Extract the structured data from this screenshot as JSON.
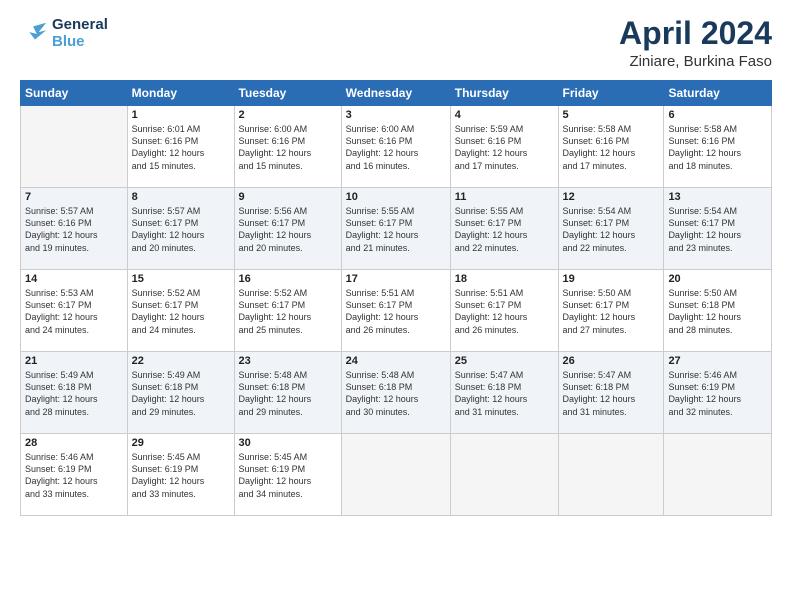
{
  "header": {
    "logo_line1": "General",
    "logo_line2": "Blue",
    "title": "April 2024",
    "location": "Ziniare, Burkina Faso"
  },
  "columns": [
    "Sunday",
    "Monday",
    "Tuesday",
    "Wednesday",
    "Thursday",
    "Friday",
    "Saturday"
  ],
  "weeks": [
    [
      {
        "day": "",
        "info": ""
      },
      {
        "day": "1",
        "info": "Sunrise: 6:01 AM\nSunset: 6:16 PM\nDaylight: 12 hours\nand 15 minutes."
      },
      {
        "day": "2",
        "info": "Sunrise: 6:00 AM\nSunset: 6:16 PM\nDaylight: 12 hours\nand 15 minutes."
      },
      {
        "day": "3",
        "info": "Sunrise: 6:00 AM\nSunset: 6:16 PM\nDaylight: 12 hours\nand 16 minutes."
      },
      {
        "day": "4",
        "info": "Sunrise: 5:59 AM\nSunset: 6:16 PM\nDaylight: 12 hours\nand 17 minutes."
      },
      {
        "day": "5",
        "info": "Sunrise: 5:58 AM\nSunset: 6:16 PM\nDaylight: 12 hours\nand 17 minutes."
      },
      {
        "day": "6",
        "info": "Sunrise: 5:58 AM\nSunset: 6:16 PM\nDaylight: 12 hours\nand 18 minutes."
      }
    ],
    [
      {
        "day": "7",
        "info": "Sunrise: 5:57 AM\nSunset: 6:16 PM\nDaylight: 12 hours\nand 19 minutes."
      },
      {
        "day": "8",
        "info": "Sunrise: 5:57 AM\nSunset: 6:17 PM\nDaylight: 12 hours\nand 20 minutes."
      },
      {
        "day": "9",
        "info": "Sunrise: 5:56 AM\nSunset: 6:17 PM\nDaylight: 12 hours\nand 20 minutes."
      },
      {
        "day": "10",
        "info": "Sunrise: 5:55 AM\nSunset: 6:17 PM\nDaylight: 12 hours\nand 21 minutes."
      },
      {
        "day": "11",
        "info": "Sunrise: 5:55 AM\nSunset: 6:17 PM\nDaylight: 12 hours\nand 22 minutes."
      },
      {
        "day": "12",
        "info": "Sunrise: 5:54 AM\nSunset: 6:17 PM\nDaylight: 12 hours\nand 22 minutes."
      },
      {
        "day": "13",
        "info": "Sunrise: 5:54 AM\nSunset: 6:17 PM\nDaylight: 12 hours\nand 23 minutes."
      }
    ],
    [
      {
        "day": "14",
        "info": "Sunrise: 5:53 AM\nSunset: 6:17 PM\nDaylight: 12 hours\nand 24 minutes."
      },
      {
        "day": "15",
        "info": "Sunrise: 5:52 AM\nSunset: 6:17 PM\nDaylight: 12 hours\nand 24 minutes."
      },
      {
        "day": "16",
        "info": "Sunrise: 5:52 AM\nSunset: 6:17 PM\nDaylight: 12 hours\nand 25 minutes."
      },
      {
        "day": "17",
        "info": "Sunrise: 5:51 AM\nSunset: 6:17 PM\nDaylight: 12 hours\nand 26 minutes."
      },
      {
        "day": "18",
        "info": "Sunrise: 5:51 AM\nSunset: 6:17 PM\nDaylight: 12 hours\nand 26 minutes."
      },
      {
        "day": "19",
        "info": "Sunrise: 5:50 AM\nSunset: 6:17 PM\nDaylight: 12 hours\nand 27 minutes."
      },
      {
        "day": "20",
        "info": "Sunrise: 5:50 AM\nSunset: 6:18 PM\nDaylight: 12 hours\nand 28 minutes."
      }
    ],
    [
      {
        "day": "21",
        "info": "Sunrise: 5:49 AM\nSunset: 6:18 PM\nDaylight: 12 hours\nand 28 minutes."
      },
      {
        "day": "22",
        "info": "Sunrise: 5:49 AM\nSunset: 6:18 PM\nDaylight: 12 hours\nand 29 minutes."
      },
      {
        "day": "23",
        "info": "Sunrise: 5:48 AM\nSunset: 6:18 PM\nDaylight: 12 hours\nand 29 minutes."
      },
      {
        "day": "24",
        "info": "Sunrise: 5:48 AM\nSunset: 6:18 PM\nDaylight: 12 hours\nand 30 minutes."
      },
      {
        "day": "25",
        "info": "Sunrise: 5:47 AM\nSunset: 6:18 PM\nDaylight: 12 hours\nand 31 minutes."
      },
      {
        "day": "26",
        "info": "Sunrise: 5:47 AM\nSunset: 6:18 PM\nDaylight: 12 hours\nand 31 minutes."
      },
      {
        "day": "27",
        "info": "Sunrise: 5:46 AM\nSunset: 6:19 PM\nDaylight: 12 hours\nand 32 minutes."
      }
    ],
    [
      {
        "day": "28",
        "info": "Sunrise: 5:46 AM\nSunset: 6:19 PM\nDaylight: 12 hours\nand 33 minutes."
      },
      {
        "day": "29",
        "info": "Sunrise: 5:45 AM\nSunset: 6:19 PM\nDaylight: 12 hours\nand 33 minutes."
      },
      {
        "day": "30",
        "info": "Sunrise: 5:45 AM\nSunset: 6:19 PM\nDaylight: 12 hours\nand 34 minutes."
      },
      {
        "day": "",
        "info": ""
      },
      {
        "day": "",
        "info": ""
      },
      {
        "day": "",
        "info": ""
      },
      {
        "day": "",
        "info": ""
      }
    ]
  ]
}
